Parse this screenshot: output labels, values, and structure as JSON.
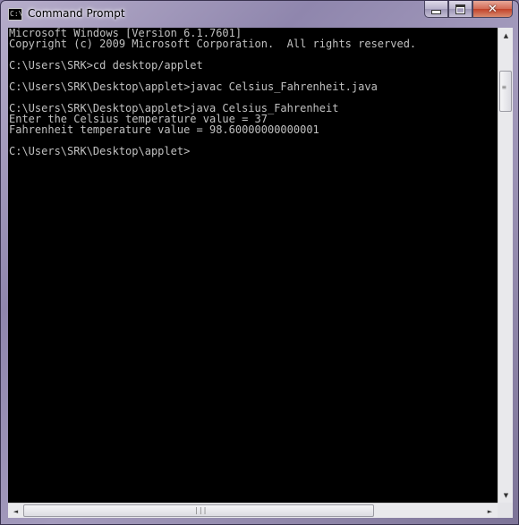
{
  "window": {
    "title": "Command Prompt",
    "icon": "console-icon",
    "icon_glyph": "C:\\"
  },
  "caption": {
    "minimize_icon": "minimize-icon",
    "maximize_icon": "maximize-icon",
    "close_icon": "close-icon",
    "close_glyph": "✕"
  },
  "console": {
    "colors": {
      "background": "#000000",
      "text": "#c0c0c0"
    },
    "lines": [
      "Microsoft Windows [Version 6.1.7601]",
      "Copyright (c) 2009 Microsoft Corporation.  All rights reserved.",
      "",
      "C:\\Users\\SRK>cd desktop/applet",
      "",
      "C:\\Users\\SRK\\Desktop\\applet>javac Celsius_Fahrenheit.java",
      "",
      "C:\\Users\\SRK\\Desktop\\applet>java Celsius_Fahrenheit",
      "Enter the Celsius temperature value = 37",
      "Fahrenheit temperature value = 98.60000000000001",
      "",
      "C:\\Users\\SRK\\Desktop\\applet>"
    ]
  },
  "scrollbars": {
    "up_arrow": "▲",
    "down_arrow": "▼",
    "left_arrow": "◄",
    "right_arrow": "►"
  }
}
